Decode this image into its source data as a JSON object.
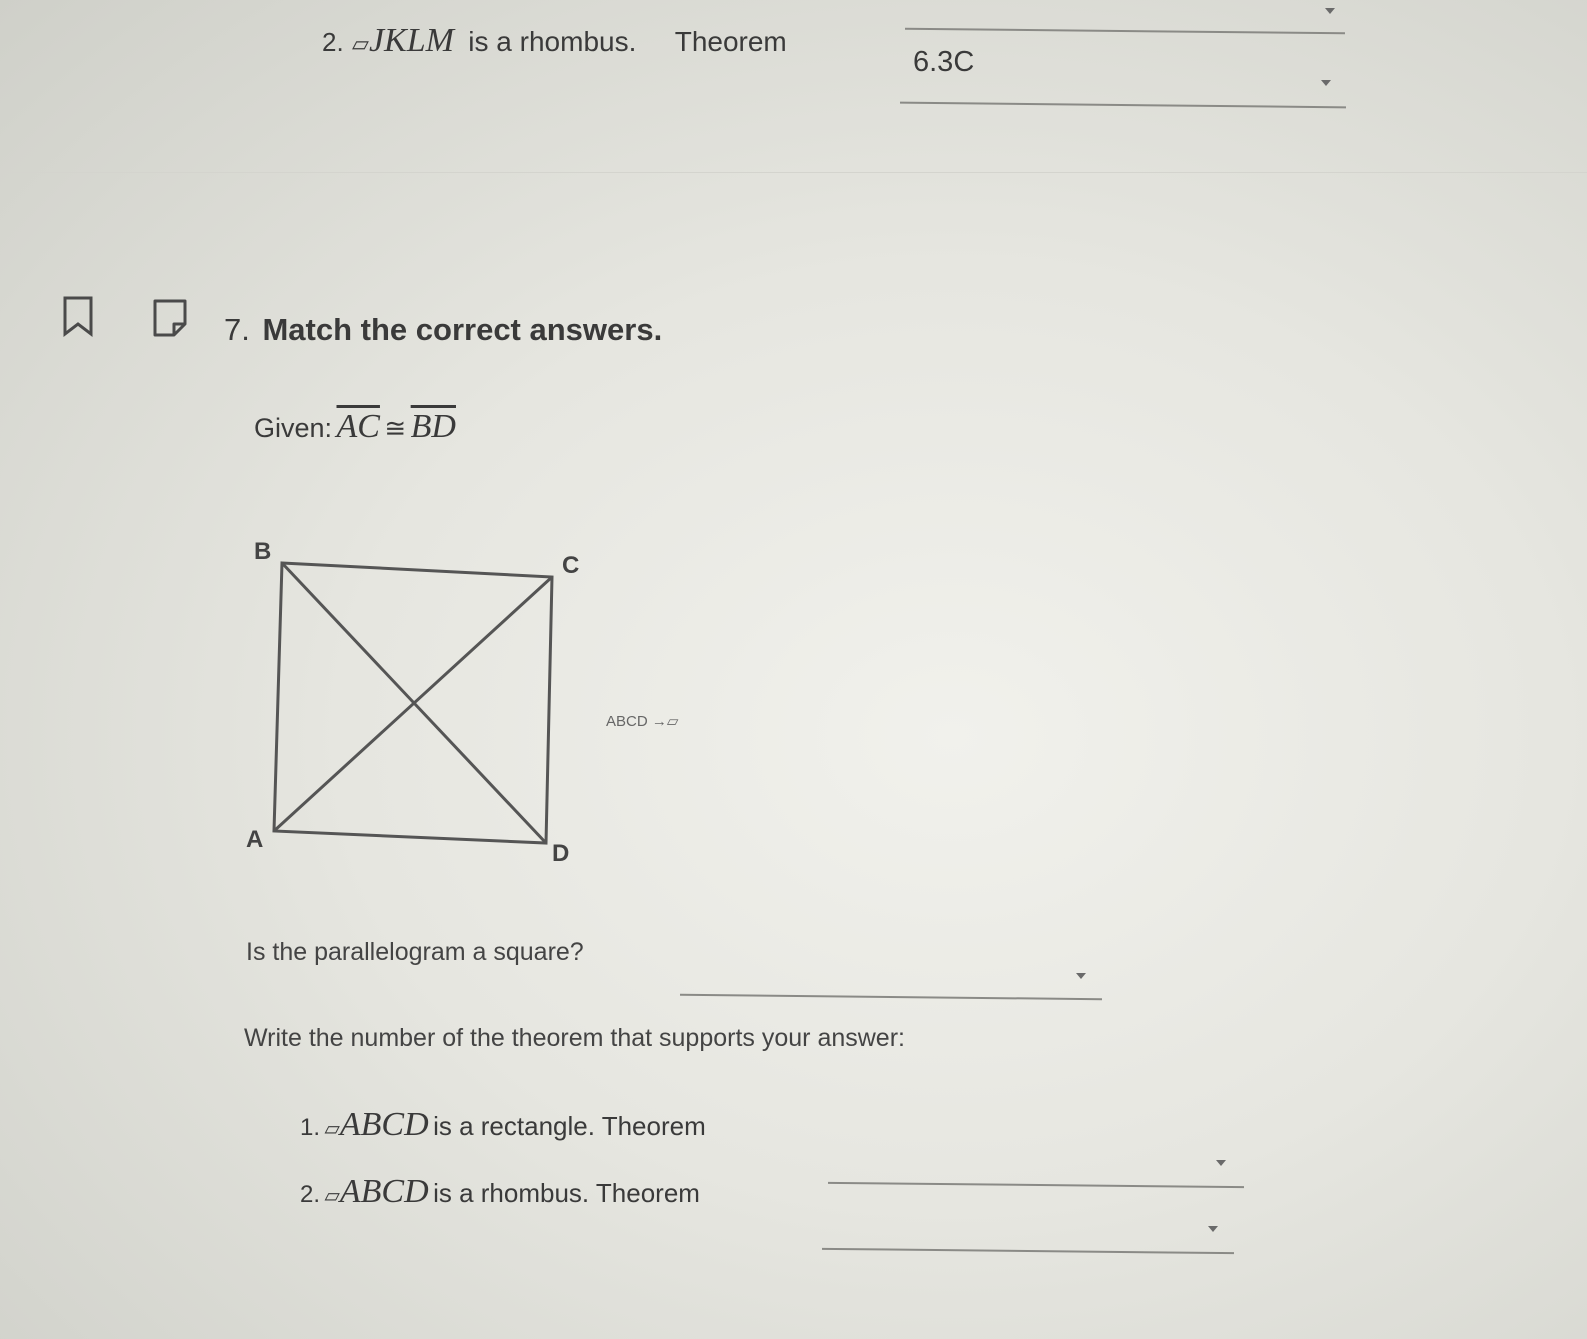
{
  "prev_item": {
    "number": "2.",
    "symbol": "▱",
    "shape": "JKLM",
    "text": "is a rhombus.",
    "theorem_label": "Theorem",
    "answer": "6.3C"
  },
  "question": {
    "number": "7.",
    "title": "Match the correct answers.",
    "given_label": "Given:",
    "given_seg1": "AC",
    "congruent": "≅",
    "given_seg2": "BD",
    "figure": {
      "labels": {
        "B": "B",
        "C": "C",
        "A": "A",
        "D": "D"
      },
      "side_note": "ABCD →▱"
    },
    "prompt": "Is the parallelogram a square?",
    "square_answer": "",
    "instruction": "Write the number of the theorem that supports your answer:",
    "items": [
      {
        "number": "1.",
        "symbol": "▱",
        "shape": "ABCD",
        "text": "is a rectangle. Theorem",
        "answer": ""
      },
      {
        "number": "2.",
        "symbol": "▱",
        "shape": "ABCD",
        "text": "is a rhombus. Theorem",
        "answer": ""
      }
    ]
  },
  "icons": {
    "bookmark": "bookmark-icon",
    "note": "note-icon"
  }
}
